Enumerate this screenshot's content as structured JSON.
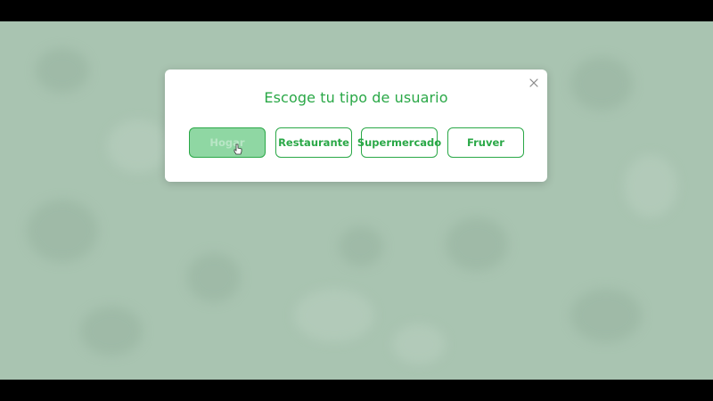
{
  "modal": {
    "title": "Escoge tu tipo de usuario",
    "close_icon": "close-icon",
    "options": [
      {
        "label": "Hogar",
        "state": "hovered"
      },
      {
        "label": "Restaurante",
        "state": "default"
      },
      {
        "label": "Supermercado",
        "state": "default"
      },
      {
        "label": "Fruver",
        "state": "default"
      }
    ]
  },
  "theme": {
    "accent": "#2aa847",
    "active_fill": "#8fd7a3",
    "backdrop": "#a9c4b1",
    "letterbox": "#000000"
  },
  "icons": {
    "close": "close-icon",
    "cursor": "hand-pointer-icon"
  }
}
